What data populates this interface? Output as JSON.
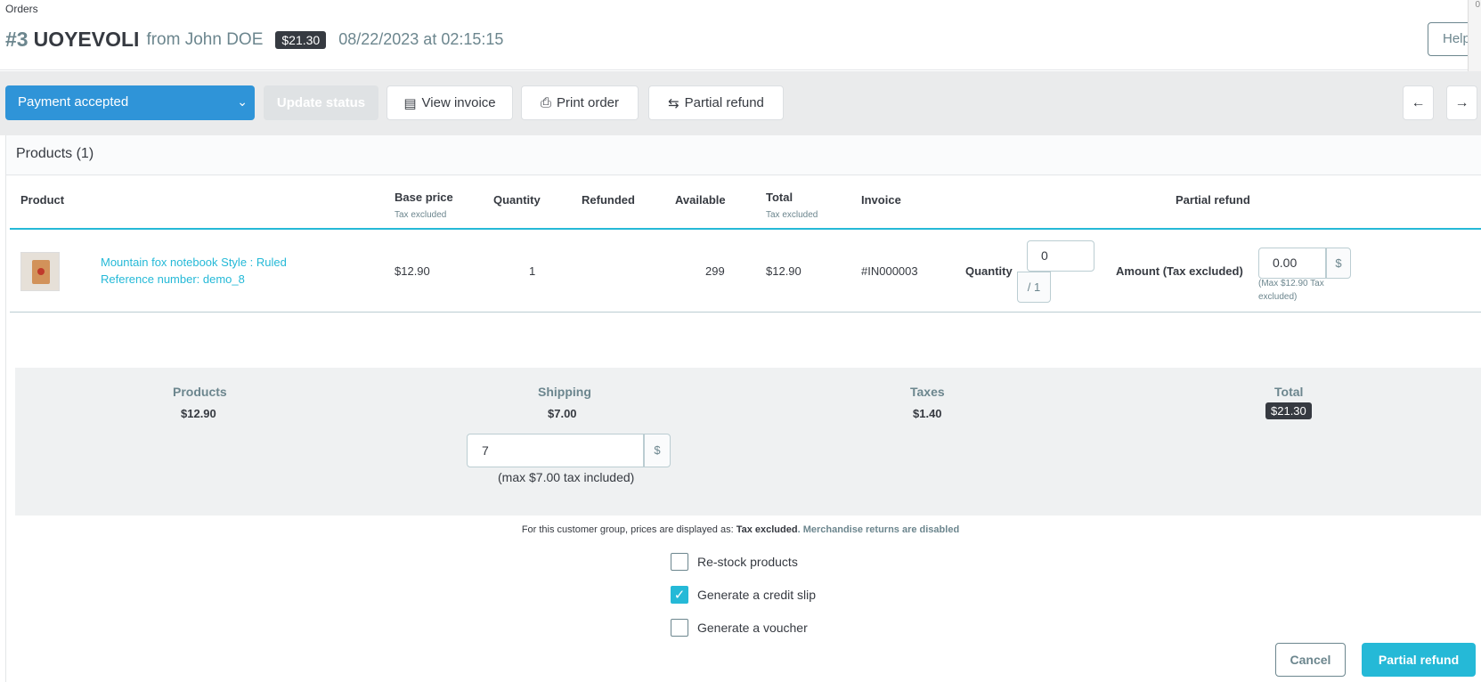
{
  "breadcrumb": "Orders",
  "order": {
    "number": "#3",
    "reference": "UOYEVOLI",
    "from": "from John DOE",
    "total_badge": "$21.30",
    "date": "08/22/2023 at 02:15:15"
  },
  "help_label": "Help",
  "scroll_hint": "0",
  "toolbar": {
    "status_value": "Payment accepted",
    "update_status": "Update status",
    "view_invoice": "View invoice",
    "print_order": "Print order",
    "partial_refund": "Partial refund"
  },
  "products": {
    "title": "Products (1)",
    "headers": {
      "product": "Product",
      "base_price": "Base price",
      "base_price_sub": "Tax excluded",
      "quantity": "Quantity",
      "refunded": "Refunded",
      "available": "Available",
      "total": "Total",
      "total_sub": "Tax excluded",
      "invoice": "Invoice",
      "partial_refund": "Partial refund"
    },
    "row": {
      "name": "Mountain fox notebook Style : Ruled",
      "reference": "Reference number: demo_8",
      "base_price": "$12.90",
      "quantity": "1",
      "refunded": "",
      "available": "299",
      "total": "$12.90",
      "invoice": "#IN000003",
      "refund_qty_label": "Quantity",
      "refund_qty_value": "0",
      "refund_qty_max": "/ 1",
      "refund_amount_label": "Amount (Tax excluded)",
      "refund_amount_value": "0.00",
      "currency": "$",
      "refund_amount_hint_1": "(Max $12.90 Tax",
      "refund_amount_hint_2": "excluded)"
    }
  },
  "summary": {
    "products_label": "Products",
    "products_value": "$12.90",
    "shipping_label": "Shipping",
    "shipping_value": "$7.00",
    "shipping_input": "7",
    "shipping_currency": "$",
    "shipping_hint": "(max $7.00 tax included)",
    "taxes_label": "Taxes",
    "taxes_value": "$1.40",
    "total_label": "Total",
    "total_value": "$21.30"
  },
  "note": {
    "prefix": "For this customer group, prices are displayed as: ",
    "tax_mode": "Tax excluded",
    "suffix": ". Merchandise returns are disabled"
  },
  "options": {
    "restock": {
      "label": "Re-stock products",
      "checked": false
    },
    "credit_slip": {
      "label": "Generate a credit slip",
      "checked": true
    },
    "voucher": {
      "label": "Generate a voucher",
      "checked": false
    }
  },
  "actions": {
    "cancel": "Cancel",
    "submit": "Partial refund"
  },
  "colors": {
    "primary": "#25b9d7",
    "status_blue": "#2f94d8",
    "dark_badge": "#363a41"
  }
}
